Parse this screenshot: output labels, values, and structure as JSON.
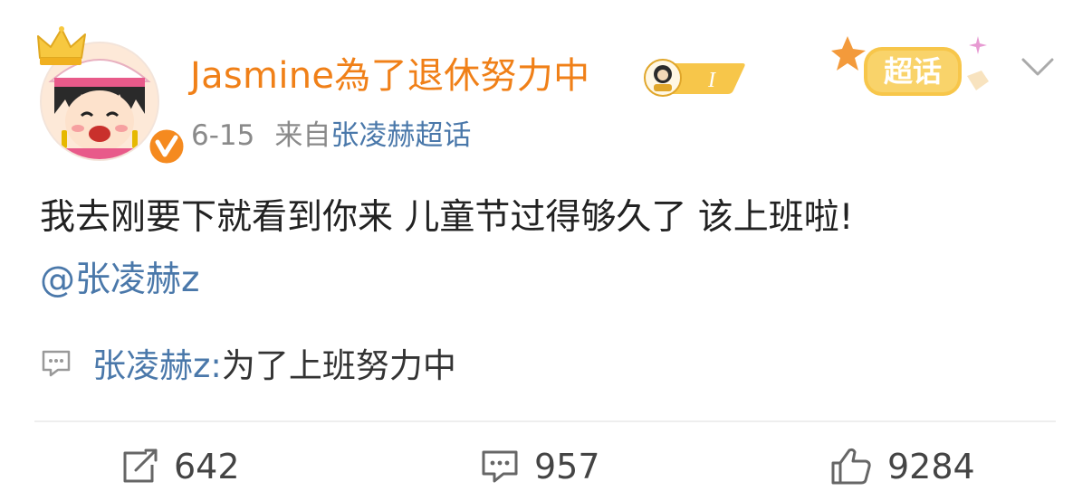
{
  "post": {
    "username": "Jasmine為了退休努力中",
    "level_badge_text": "I",
    "date": "6-15",
    "source_prefix": "来自",
    "source_name": "张凌赫超话",
    "content": "我去刚要下就看到你来 儿童节过得够久了 该上班啦!",
    "mention": "@张凌赫z",
    "supertopic_badge": "超话",
    "origin": {
      "author": "张凌赫z:",
      "text": " 为了上班努力中"
    }
  },
  "stats": {
    "reposts": "642",
    "comments": "957",
    "likes": "9284"
  },
  "icons": {
    "crown": "crown-icon",
    "verified": "verified-badge-icon",
    "chevron": "chevron-down-icon",
    "origin": "comment-icon",
    "repost": "repost-icon",
    "comment": "comment-icon",
    "like": "like-icon"
  },
  "colors": {
    "username": "#f08018",
    "link": "#4a78aa",
    "meta": "#8a8a8a",
    "verified": "#f58a1f",
    "supertopic": "#f7c64a"
  }
}
